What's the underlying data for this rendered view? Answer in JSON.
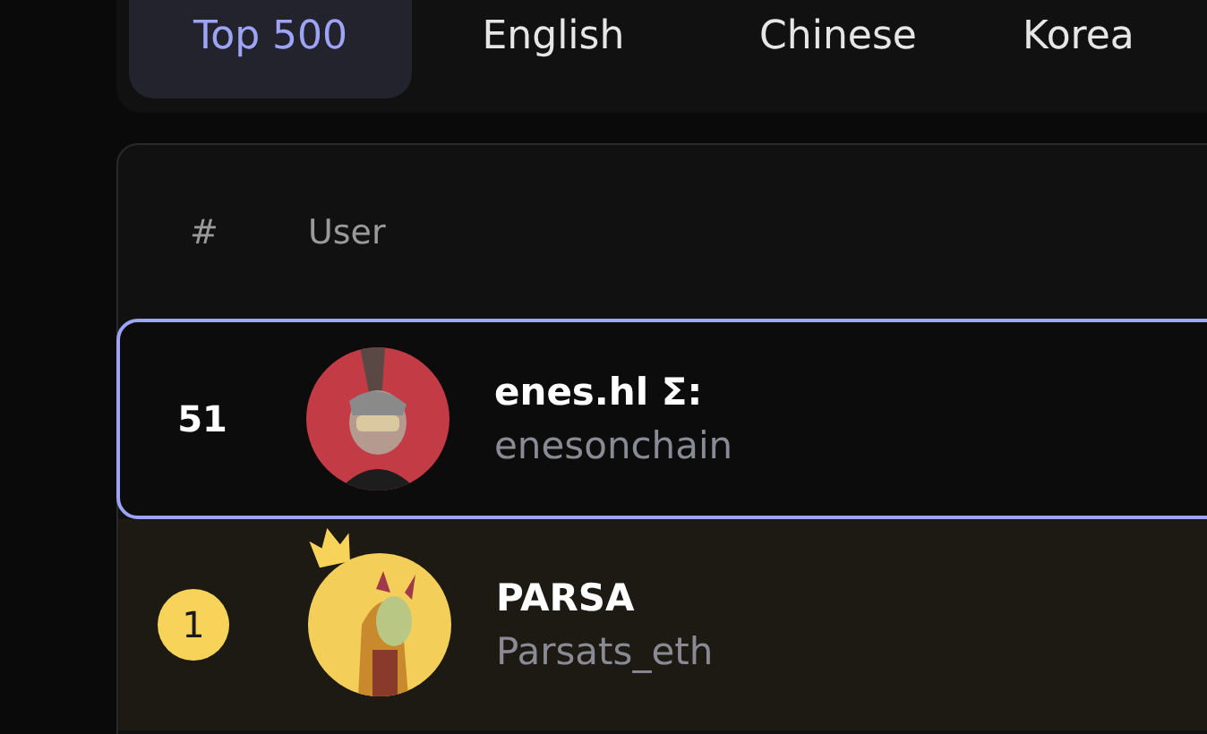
{
  "tabs": [
    {
      "label": "Top 500",
      "selected": true
    },
    {
      "label": "English",
      "selected": false
    },
    {
      "label": "Chinese",
      "selected": false
    },
    {
      "label": "Korea",
      "selected": false
    }
  ],
  "table": {
    "columns": [
      "#",
      "User"
    ],
    "rows": [
      {
        "rank": "51",
        "name": "enes.hl Σ:",
        "handle": "enesonchain",
        "current_user": true,
        "top_rank": false
      },
      {
        "rank": "1",
        "name": "PARSA",
        "handle": "Parsats_eth",
        "current_user": false,
        "top_rank": true
      }
    ]
  }
}
